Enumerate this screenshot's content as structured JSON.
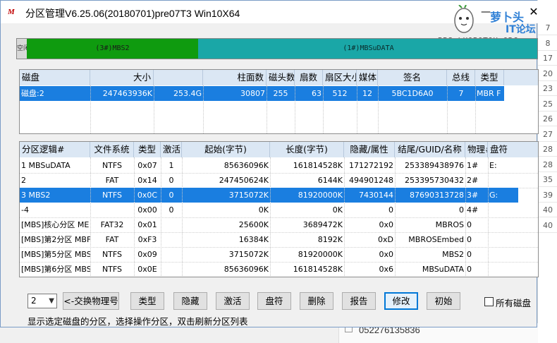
{
  "window": {
    "title": "分区管理V6.25.06(20180701)pre07T3 Win10X64",
    "min_glyph": "—",
    "close_glyph": "✕",
    "app_icon_glyph": "M"
  },
  "watermark": {
    "line1": "萝卜头",
    "line2": "IT论坛",
    "line3": "BBS.LUOBOTOU.ORG"
  },
  "partition_bar": {
    "segments": [
      {
        "label": "(3#)MBS2",
        "color": "#0f9b0f"
      },
      {
        "label": "(1#)MBSuDATA",
        "color": "#1aa7a7"
      }
    ],
    "left_sliver_label": "空闲"
  },
  "disk_table": {
    "columns": [
      "磁盘",
      "大小",
      "",
      "柱面数",
      "磁头数",
      "扇数",
      "扇区大小",
      "媒体",
      "签名",
      "总线",
      "类型"
    ],
    "rows": [
      {
        "disk": "磁盘:2",
        "size": "247463936K",
        "size_gb": "253.4G",
        "cylinders": "30807",
        "heads": "255",
        "sectors": "63",
        "sector_size": "512",
        "media": "12",
        "signature": "5BC1D6A0",
        "bus": "7",
        "type": "MBR F"
      }
    ]
  },
  "part_table": {
    "columns": [
      "分区逻辑#",
      "文件系统",
      "类型",
      "激活",
      "起始(字节)",
      "长度(字节)",
      "隐藏/属性",
      "结尾/GUID/名称",
      "物理#",
      "盘符"
    ],
    "rows": [
      {
        "name": "1 MBSuDATA",
        "fs": "NTFS",
        "type": "0x07",
        "active": "1",
        "start": "85636096K",
        "length": "161814528K",
        "hidden": "171272192",
        "end": "253389438976",
        "phys": "1#",
        "drive": "E:",
        "selected": false
      },
      {
        "name": "2",
        "fs": "FAT",
        "type": "0x14",
        "active": "0",
        "start": "247450624K",
        "length": "6144K",
        "hidden": "494901248",
        "end": "253395730432",
        "phys": "2#",
        "drive": "",
        "selected": false
      },
      {
        "name": "3 MBS2",
        "fs": "NTFS",
        "type": "0x0C",
        "active": "0",
        "start": "3715072K",
        "length": "81920000K",
        "hidden": "7430144",
        "end": "87690313728",
        "phys": "3#",
        "drive": "G:",
        "selected": true
      },
      {
        "name": "-4",
        "fs": "",
        "type": "0x00",
        "active": "0",
        "start": "0K",
        "length": "0K",
        "hidden": "0",
        "end": "0",
        "phys": "4#",
        "drive": "",
        "selected": false
      },
      {
        "name": "[MBS]核心分区 ME",
        "fs": "FAT32",
        "type": "0x01",
        "active": "",
        "start": "25600K",
        "length": "3689472K",
        "hidden": "0x0",
        "end": "MBROS",
        "phys": "0",
        "drive": "",
        "selected": false
      },
      {
        "name": "[MBS]第2分区 MBF",
        "fs": "FAT",
        "type": "0xF3",
        "active": "",
        "start": "16384K",
        "length": "8192K",
        "hidden": "0xD",
        "end": "MBROSEmbed",
        "phys": "0",
        "drive": "",
        "selected": false
      },
      {
        "name": "[MBS]第5分区 MBS",
        "fs": "NTFS",
        "type": "0x09",
        "active": "",
        "start": "3715072K",
        "length": "81920000K",
        "hidden": "0x0",
        "end": "MBS2",
        "phys": "0",
        "drive": "",
        "selected": false
      },
      {
        "name": "[MBS]第6分区 MBS",
        "fs": "NTFS",
        "type": "0x0E",
        "active": "",
        "start": "85636096K",
        "length": "161814528K",
        "hidden": "0x6",
        "end": "MBSuDATA",
        "phys": "0",
        "drive": "",
        "selected": false
      }
    ]
  },
  "controls": {
    "disk_select_value": "2",
    "buttons": [
      "<-交换物理号",
      "类型",
      "隐藏",
      "激活",
      "盘符",
      "删除",
      "报告",
      "修改",
      "初始"
    ],
    "all_disks_label": "所有磁盘",
    "status": "显示选定磁盘的分区，选择操作分区，双击刷新分区列表"
  },
  "background": {
    "right_rows": [
      "7",
      "8",
      "17",
      "20",
      "23",
      "25",
      "26",
      "27",
      "28",
      "28",
      "35",
      "39",
      "40",
      "40"
    ],
    "bottom_text": "052276135836"
  }
}
